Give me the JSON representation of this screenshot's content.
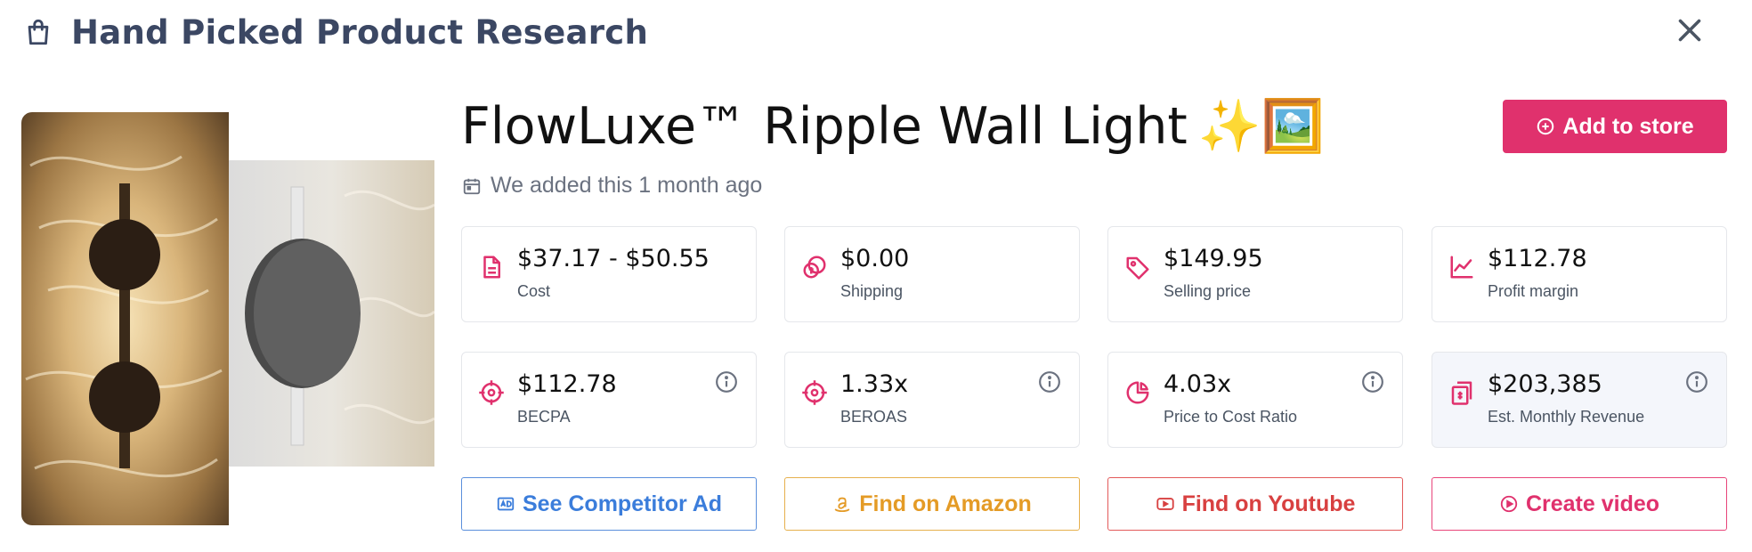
{
  "header": {
    "title": "Hand Picked Product Research"
  },
  "product": {
    "title": "FlowLuxe™ Ripple Wall Light",
    "emoji": "✨🖼️",
    "added_text": "We added this 1 month ago"
  },
  "actions": {
    "add_to_store": "Add to store"
  },
  "stats": [
    {
      "value": "$37.17 - $50.55",
      "label": "Cost",
      "icon": "document-icon"
    },
    {
      "value": "$0.00",
      "label": "Shipping",
      "icon": "coins-icon"
    },
    {
      "value": "$149.95",
      "label": "Selling price",
      "icon": "tag-icon"
    },
    {
      "value": "$112.78",
      "label": "Profit margin",
      "icon": "chart-line-icon"
    },
    {
      "value": "$112.78",
      "label": "BECPA",
      "icon": "target-icon"
    },
    {
      "value": "1.33x",
      "label": "BEROAS",
      "icon": "target-icon"
    },
    {
      "value": "4.03x",
      "label": "Price to Cost Ratio",
      "icon": "pie-icon"
    },
    {
      "value": "$203,385",
      "label": "Est. Monthly Revenue",
      "icon": "revenue-icon"
    }
  ],
  "buttons": {
    "competitor_ad": "See Competitor Ad",
    "amazon": "Find on Amazon",
    "youtube": "Find on Youtube",
    "create_video": "Create video"
  },
  "colors": {
    "accent": "#e0316d",
    "blue": "#3b7ddb",
    "orange": "#e49b26",
    "red": "#d84040"
  }
}
